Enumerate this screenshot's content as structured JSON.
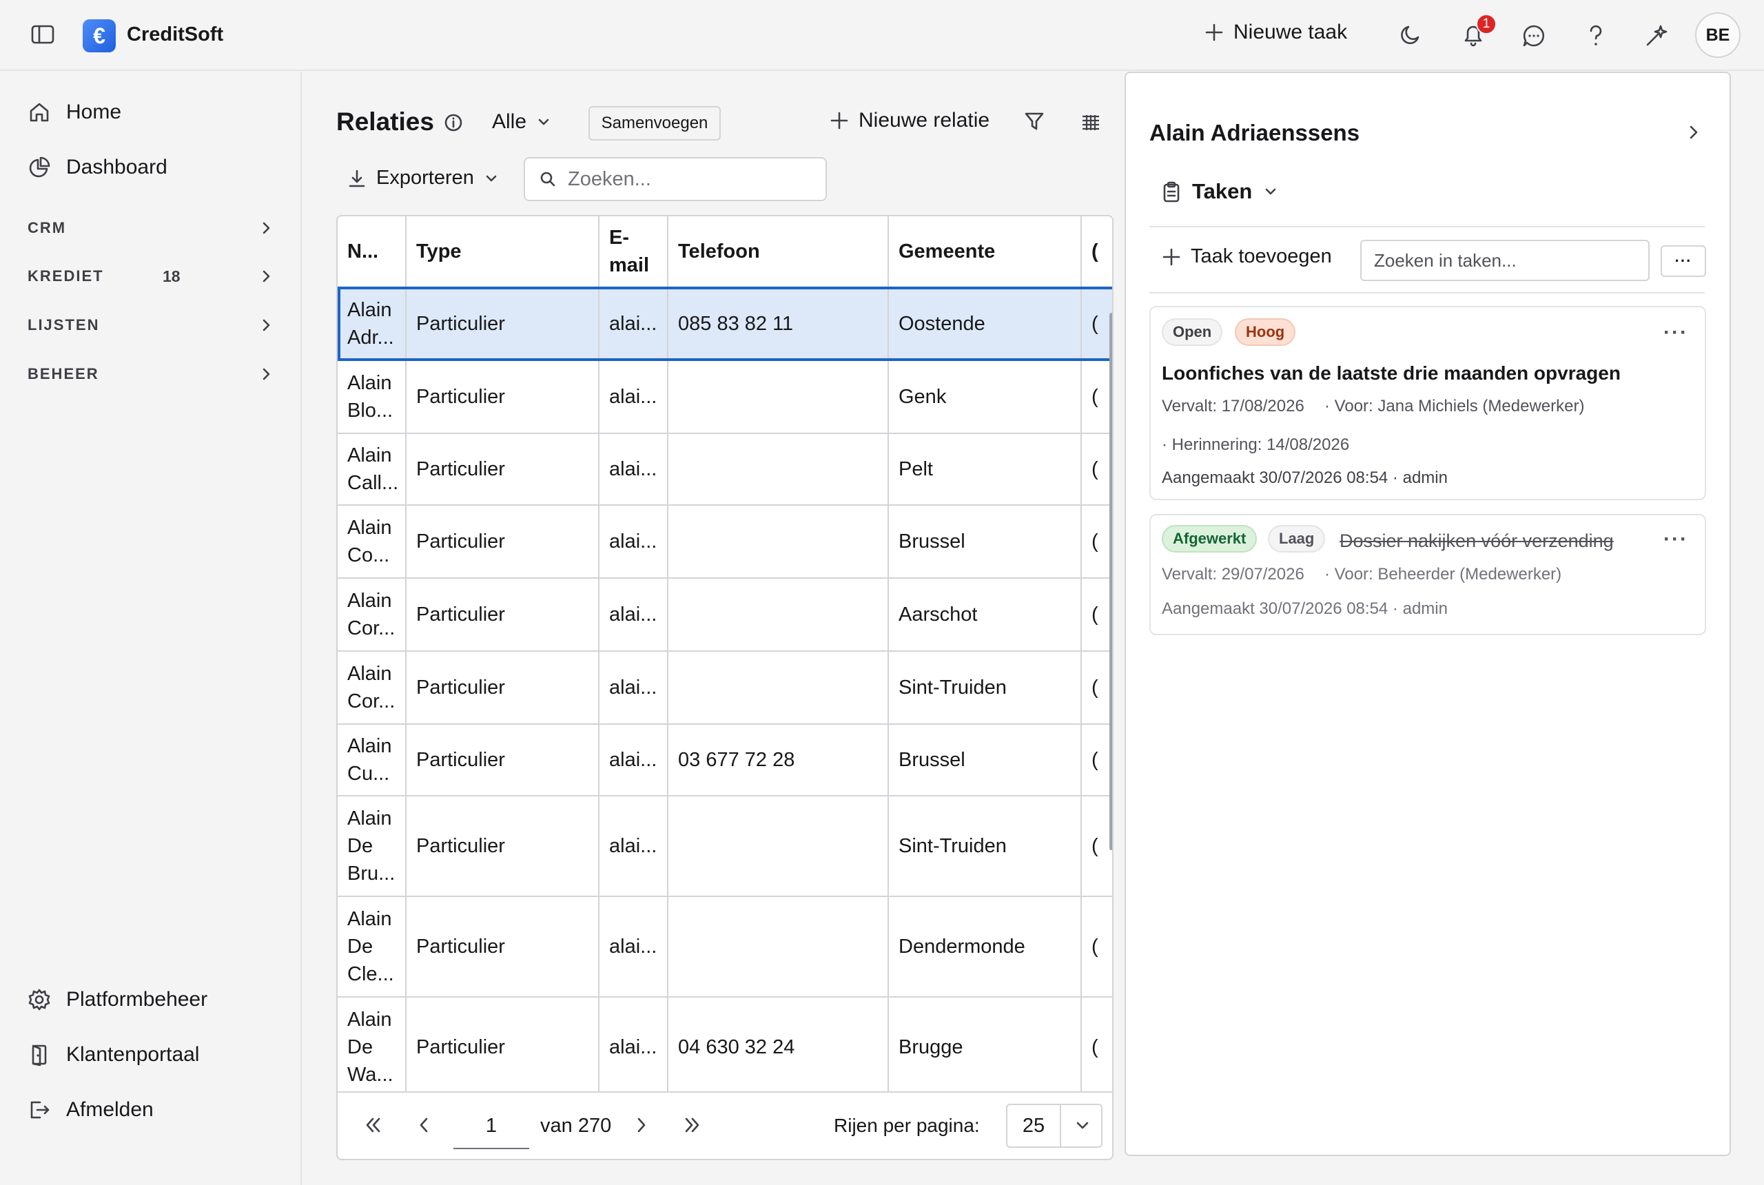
{
  "app": {
    "brand": "CreditSoft",
    "logo_glyph": "€"
  },
  "topbar": {
    "new_task_label": "Nieuwe taak",
    "notification_count": "1",
    "avatar_initials": "BE"
  },
  "sidebar": {
    "home": "Home",
    "dashboard": "Dashboard",
    "sections": [
      {
        "label": "CRM",
        "count": ""
      },
      {
        "label": "KREDIET",
        "count": "18"
      },
      {
        "label": "LIJSTEN",
        "count": ""
      },
      {
        "label": "BEHEER",
        "count": ""
      }
    ],
    "bottom": [
      "Platformbeheer",
      "Klantenportaal",
      "Afmelden"
    ]
  },
  "list": {
    "title": "Relaties",
    "filter_value": "Alle",
    "merge_button": "Samenvoegen",
    "new_relation": "Nieuwe relatie",
    "export_label": "Exporteren",
    "search_placeholder": "Zoeken...",
    "columns": [
      "N...",
      "Type",
      "E-\nmail",
      "Telefoon",
      "Gemeente",
      "("
    ],
    "rows": [
      {
        "name": "Alain\nAdr...",
        "type": "Particulier",
        "email": "alai...",
        "phone": "085 83 82 11",
        "city": "Oostende",
        "extra": "("
      },
      {
        "name": "Alain\nBlo...",
        "type": "Particulier",
        "email": "alai...",
        "phone": "",
        "city": "Genk",
        "extra": "("
      },
      {
        "name": "Alain\nCall...",
        "type": "Particulier",
        "email": "alai...",
        "phone": "",
        "city": "Pelt",
        "extra": "("
      },
      {
        "name": "Alain\nCo...",
        "type": "Particulier",
        "email": "alai...",
        "phone": "",
        "city": "Brussel",
        "extra": "("
      },
      {
        "name": "Alain\nCor...",
        "type": "Particulier",
        "email": "alai...",
        "phone": "",
        "city": "Aarschot",
        "extra": "("
      },
      {
        "name": "Alain\nCor...",
        "type": "Particulier",
        "email": "alai...",
        "phone": "",
        "city": "Sint-Truiden",
        "extra": "("
      },
      {
        "name": "Alain\nCu...",
        "type": "Particulier",
        "email": "alai...",
        "phone": "03 677 72 28",
        "city": "Brussel",
        "extra": "("
      },
      {
        "name": "Alain\nDe\nBru...",
        "type": "Particulier",
        "email": "alai...",
        "phone": "",
        "city": "Sint-Truiden",
        "extra": "("
      },
      {
        "name": "Alain\nDe\nCle...",
        "type": "Particulier",
        "email": "alai...",
        "phone": "",
        "city": "Dendermonde",
        "extra": "("
      },
      {
        "name": "Alain\nDe\nWa...",
        "type": "Particulier",
        "email": "alai...",
        "phone": "04 630 32 24",
        "city": "Brugge",
        "extra": "("
      }
    ],
    "pager": {
      "page": "1",
      "of_label": "van 270",
      "rows_label": "Rijen per pagina:",
      "rows_value": "25"
    }
  },
  "panel": {
    "title": "Alain Adriaenssens",
    "section": "Taken",
    "add_task": "Taak toevoegen",
    "search_placeholder": "Zoeken in taken...",
    "more": "···",
    "tasks": [
      {
        "status": "Open",
        "priority": "Hoog",
        "title": "Loonfiches van de laatste drie maanden opvragen",
        "due": "Vervalt: 17/08/2026",
        "assignee": "· Voor: Jana Michiels (Medewerker)",
        "reminder": "· Herinnering: 14/08/2026",
        "created": "Aangemaakt 30/07/2026 08:54 · admin"
      },
      {
        "status": "Afgewerkt",
        "priority": "Laag",
        "title": "Dossier nakijken vóór verzending",
        "due": "Vervalt: 29/07/2026",
        "assignee": "· Voor: Beheerder (Medewerker)",
        "created": "Aangemaakt 30/07/2026 08:54 · admin"
      }
    ]
  }
}
